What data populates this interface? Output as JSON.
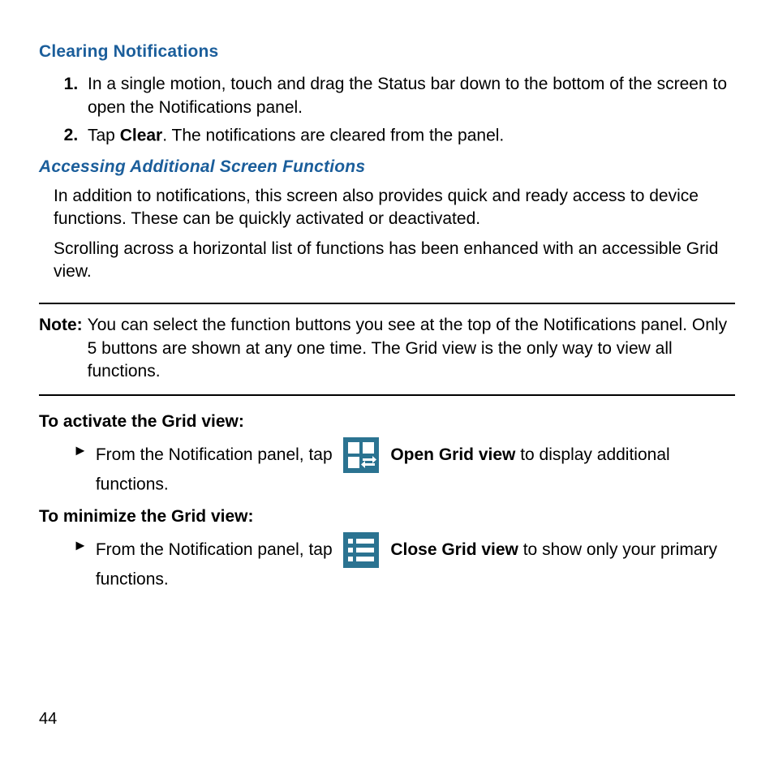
{
  "headings": {
    "clearing": "Clearing Notifications",
    "accessing": "Accessing Additional Screen Functions",
    "activate": "To activate the Grid view:",
    "minimize": "To minimize the Grid view:"
  },
  "steps": {
    "s1": "In a single motion, touch and drag the Status bar down to the bottom of the screen to open the Notifications panel.",
    "s2_pre": "Tap ",
    "s2_bold": "Clear",
    "s2_post": ". The notifications are cleared from the panel."
  },
  "paragraphs": {
    "p1": "In addition to notifications, this screen also provides quick and ready access to device functions. These can be quickly activated or deactivated.",
    "p2": "Scrolling across a horizontal list of functions has been enhanced with an accessible Grid view."
  },
  "note": {
    "label": "Note:",
    "text": "You can select the function buttons you see at the top of the Notifications panel. Only 5 buttons are shown at any one time. The Grid view is the only way to view all functions."
  },
  "grid": {
    "activate_pre": "From the Notification panel, tap ",
    "activate_bold": "Open Grid view",
    "activate_post": " to display additional functions.",
    "minimize_pre": "From the Notification panel, tap ",
    "minimize_bold": "Close Grid view",
    "minimize_post": " to show only your primary functions."
  },
  "icons": {
    "open_grid": "open-grid-view-icon",
    "close_grid": "close-grid-view-icon"
  },
  "page_number": "44"
}
